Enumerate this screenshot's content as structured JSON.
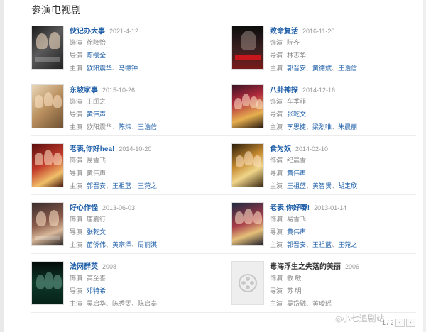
{
  "section": {
    "title": "参演电视剧"
  },
  "labels": {
    "role": "饰演",
    "director": "导演",
    "cast": "主演"
  },
  "films": [
    {
      "title": "伙记办大事",
      "date": "2021-4-12",
      "role": "徐隆怡",
      "director": [
        "陈缨全"
      ],
      "cast": [
        "欧阳震华",
        "马德钟"
      ]
    },
    {
      "title": "致命复活",
      "date": "2016-11-20",
      "role": "阮齐",
      "director": [
        "林志华"
      ],
      "cast": [
        "郭晋安",
        "黄德斌",
        "王浩信"
      ]
    },
    {
      "title": "东坡家事",
      "date": "2015-10-26",
      "role": "王闰之",
      "director": [
        "黄伟声"
      ],
      "cast": [
        "欧阳震华",
        "陈炜",
        "王浩信"
      ]
    },
    {
      "title": "八卦神探",
      "date": "2014-12-16",
      "role": "车季菲",
      "director": [
        "张乾文"
      ],
      "cast": [
        "李思捷",
        "梁烈唯",
        "朱晨丽"
      ]
    },
    {
      "title": "老表,你好hea!",
      "date": "2014-10-20",
      "role": "易雪飞",
      "director": [
        "黄伟声"
      ],
      "cast": [
        "郭晋安",
        "王祖蓝",
        "王菀之"
      ]
    },
    {
      "title": "食为奴",
      "date": "2014-02-10",
      "role": "纪晨雪",
      "director": [
        "黄伟声"
      ],
      "cast": [
        "王祖蓝",
        "黄智贤",
        "胡定欣"
      ]
    },
    {
      "title": "好心作怪",
      "date": "2013-06-03",
      "role": "唐嘉行",
      "director": [
        "张乾文"
      ],
      "cast": [
        "苗侨伟",
        "黄宗泽",
        "周丽淇"
      ]
    },
    {
      "title": "老表,你好嘢!",
      "date": "2013-01-14",
      "role": "易雪飞",
      "director": [
        "黄伟声"
      ],
      "cast": [
        "郭晋安",
        "王祖蓝",
        "王菀之"
      ]
    },
    {
      "title": "法网群英",
      "date": "2008",
      "role": "高至善",
      "director": [
        "邓特希"
      ],
      "cast": [
        "吴启华",
        "陈秀雯",
        "陈启泰"
      ]
    },
    {
      "title": "毒海浮生之失落的美丽",
      "date": "2006",
      "role": "敏 敏",
      "director": [
        "苏 明"
      ],
      "cast": [
        "吴岱融",
        "黄璦瑶"
      ]
    }
  ],
  "watermark": {
    "text": "小七追剧站"
  },
  "pager": {
    "current": "1",
    "total": "2",
    "separator": "/"
  },
  "colors": {
    "link": "#1f5fa8",
    "date": "#999999",
    "divider": "#ececec"
  }
}
